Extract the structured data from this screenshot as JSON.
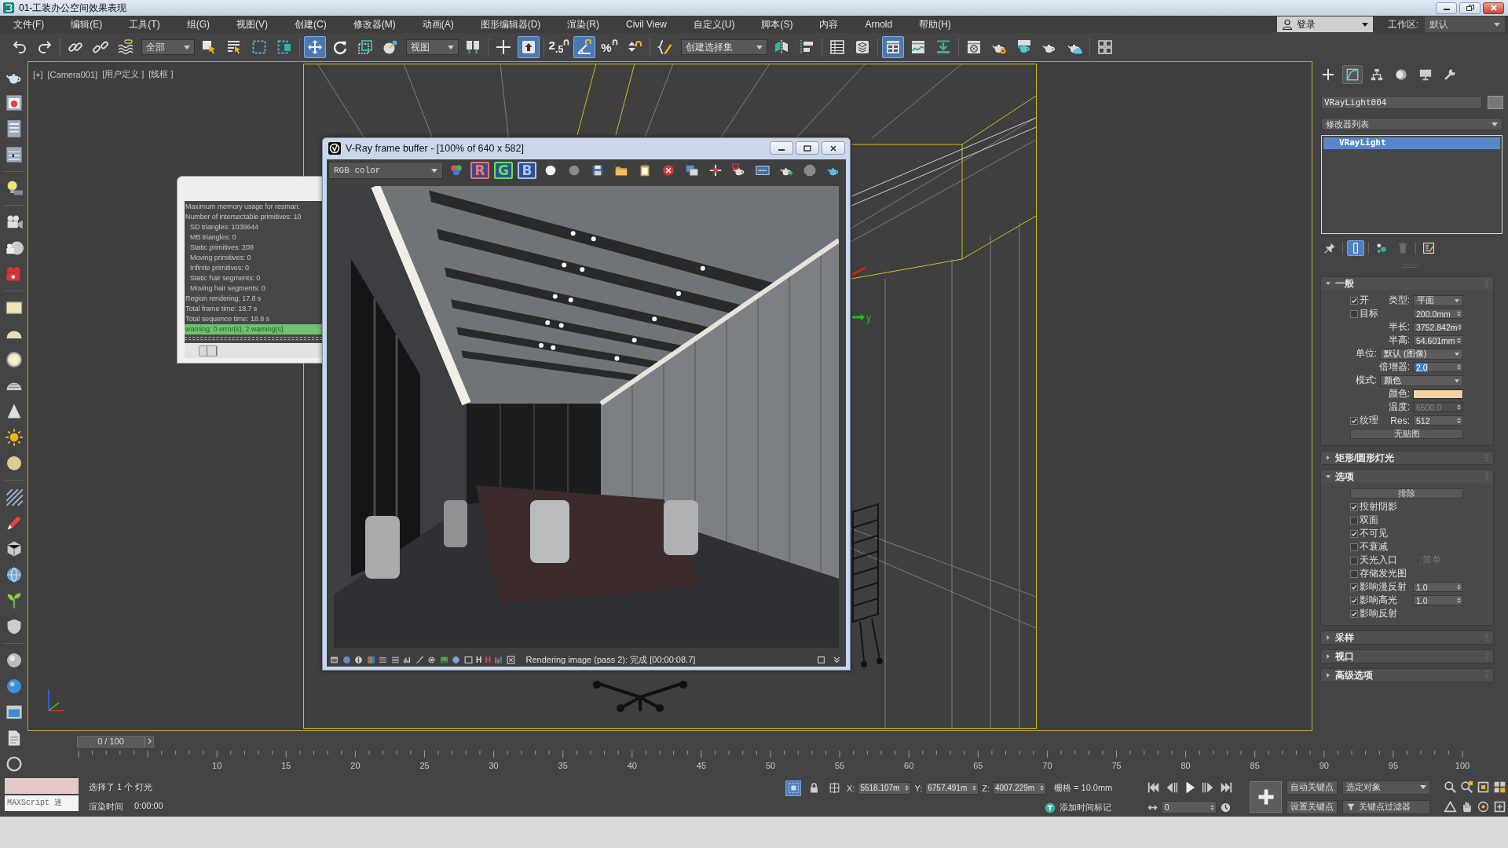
{
  "window": {
    "title": "01-工装办公空间效果表现"
  },
  "menu_bar": {
    "items": [
      "文件(F)",
      "编辑(E)",
      "工具(T)",
      "组(G)",
      "视图(V)",
      "创建(C)",
      "修改器(M)",
      "动画(A)",
      "图形编辑器(D)",
      "渲染(R)",
      "Civil View",
      "自定义(U)",
      "脚本(S)",
      "内容",
      "Arnold",
      "帮助(H)"
    ],
    "login": "登录",
    "workspace_label": "工作区:",
    "workspace": "默认"
  },
  "toolbar": [
    {
      "kind": "undo",
      "selected": false
    },
    {
      "kind": "redo",
      "selected": false
    },
    {
      "kind": "link",
      "selected": false
    },
    {
      "kind": "unlink",
      "selected": false
    },
    {
      "kind": "bind",
      "selected": false
    },
    {
      "kind": "dropdown",
      "value": "全部"
    },
    {
      "kind": "select",
      "selected": false
    },
    {
      "kind": "select_by_name",
      "selected": false
    },
    {
      "kind": "region",
      "selected": false
    },
    {
      "kind": "crossing",
      "selected": false
    },
    {
      "kind": "move",
      "selected": true
    },
    {
      "kind": "rotate",
      "selected": false
    },
    {
      "kind": "scale",
      "selected": false
    },
    {
      "kind": "place",
      "selected": false
    },
    {
      "kind": "dropdown",
      "value": "视图"
    },
    {
      "kind": "pivot",
      "selected": false
    },
    {
      "kind": "manipulate",
      "selected": false
    },
    {
      "kind": "override",
      "selected": true
    },
    {
      "kind": "snap",
      "selected": false,
      "label": "2$_{.5}$"
    },
    {
      "kind": "angle_snap",
      "selected": true
    },
    {
      "kind": "percent_snap",
      "selected": false,
      "label": "%"
    },
    {
      "kind": "spinner_snap",
      "selected": false
    },
    {
      "kind": "named_sets",
      "selected": false
    },
    {
      "kind": "dropdown",
      "value": "创建选择集"
    },
    {
      "kind": "mirror",
      "selected": false
    },
    {
      "kind": "align",
      "selected": false
    },
    {
      "kind": "layers",
      "selected": false
    },
    {
      "kind": "scene_explorer",
      "selected": false
    },
    {
      "kind": "ribbon",
      "selected": true
    },
    {
      "kind": "curve_editor",
      "selected": false
    },
    {
      "kind": "schematic",
      "selected": false
    },
    {
      "kind": "material_editor",
      "selected": false
    },
    {
      "kind": "render_setup",
      "selected": false
    },
    {
      "kind": "frame_window",
      "selected": false
    },
    {
      "kind": "render",
      "selected": false
    },
    {
      "kind": "cloud_render",
      "selected": false
    },
    {
      "kind": "viewports",
      "selected": false
    }
  ],
  "viewport": {
    "labels": [
      "[+]",
      "[Camera001]",
      "[用户定义 ]",
      "[线框 ]"
    ],
    "axis_label": "y"
  },
  "log_window": {
    "lines": [
      {
        "text": "Maximum memory usage for resman:",
        "highlighted": false
      },
      {
        "text": "Number of intersectable primitives: 10",
        "highlighted": false,
        "children": [
          {
            "text": "SD triangles: 1039644",
            "highlighted": false
          },
          {
            "text": "MB triangles: 0",
            "highlighted": false
          },
          {
            "text": "Static primitives: 208",
            "highlighted": false
          },
          {
            "text": "Moving primitives: 0",
            "highlighted": false
          },
          {
            "text": "Infinite primitives: 0",
            "highlighted": false
          },
          {
            "text": "Static hair segments: 0",
            "highlighted": false
          },
          {
            "text": "Moving hair segments: 0",
            "highlighted": false
          }
        ]
      },
      {
        "text": "Region rendering: 17.8 s",
        "highlighted": false
      },
      {
        "text": "Total frame time: 18.7 s",
        "highlighted": false
      },
      {
        "text": "Total sequence time: 18.8 s",
        "highlighted": false
      },
      {
        "text": "warning: 0 error(s), 2 warning(s)",
        "highlighted": true
      }
    ]
  },
  "vray_frame_buffer": {
    "title": "V-Ray frame buffer - [100% of 640 x 582]",
    "channel": "RGB color",
    "tools": [
      {
        "kind": "color_channels",
        "selected": false
      },
      {
        "kind": "channel",
        "label": "R",
        "color": "#ff7070",
        "selected": true
      },
      {
        "kind": "channel",
        "label": "G",
        "color": "#66e066",
        "selected": true
      },
      {
        "kind": "channel",
        "label": "B",
        "color": "#a8c4ff",
        "selected": true
      },
      {
        "kind": "white_dot",
        "selected": false
      },
      {
        "kind": "gray_dot",
        "selected": false
      },
      {
        "kind": "save",
        "selected": false
      },
      {
        "kind": "open",
        "selected": false
      },
      {
        "kind": "clipboard",
        "selected": false
      },
      {
        "kind": "clear",
        "selected": false
      },
      {
        "kind": "duplicate",
        "selected": false
      },
      {
        "kind": "track",
        "selected": false
      },
      {
        "kind": "region_render",
        "selected": false
      },
      {
        "kind": "lut",
        "selected": false
      },
      {
        "kind": "render_last",
        "selected": false
      },
      {
        "kind": "stop",
        "selected": false
      },
      {
        "kind": "interactive",
        "selected": false
      }
    ],
    "status_letters": [
      "H",
      "H"
    ],
    "status": "Rendering image (pass 2): 完成 [00:00:08.7]"
  },
  "command_panel": {
    "tabs": [
      {
        "kind": "create",
        "selected": false
      },
      {
        "kind": "modify",
        "selected": true
      },
      {
        "kind": "hierarchy",
        "selected": false
      },
      {
        "kind": "motion",
        "selected": false
      },
      {
        "kind": "display",
        "selected": false
      },
      {
        "kind": "utilities",
        "selected": false
      }
    ],
    "object_name": "VRayLight004",
    "modifier_list": "修改器列表",
    "stack": [
      {
        "label": "VRayLight",
        "selected": true
      }
    ],
    "stack_tools": [
      {
        "kind": "pin",
        "selected": false,
        "disabled": false
      },
      {
        "kind": "end_result",
        "selected": true,
        "disabled": false
      },
      {
        "kind": "make_unique",
        "selected": false,
        "disabled": false
      },
      {
        "kind": "remove",
        "selected": false,
        "disabled": true
      },
      {
        "kind": "configure",
        "selected": false,
        "disabled": false
      }
    ],
    "rollouts": [
      {
        "title": "一般",
        "expanded": true,
        "rows": [
          {
            "kind": "check",
            "label": "开",
            "checked": true,
            "disabled": false,
            "side": {
              "kind": "dropdown",
              "label": "类型:",
              "value": "平面",
              "disabled": false
            }
          },
          {
            "kind": "check",
            "label": "目标",
            "checked": false,
            "disabled": false,
            "side": {
              "kind": "spinner",
              "value": "200.0mm",
              "disabled": false,
              "focused": false
            }
          },
          {
            "kind": "spinner",
            "label": "半长:",
            "value": "3752.842m",
            "disabled": false,
            "focused": false
          },
          {
            "kind": "spinner",
            "label": "半高:",
            "value": "54.601mm",
            "disabled": false,
            "focused": false
          },
          {
            "kind": "dropdown",
            "label": "单位:",
            "value": "默认 (图像)",
            "disabled": false
          },
          {
            "kind": "spinner",
            "label": "倍增器:",
            "value": "2.0",
            "disabled": false,
            "focused": true
          },
          {
            "kind": "dropdown",
            "label": "模式:",
            "value": "颜色",
            "disabled": false
          },
          {
            "kind": "color",
            "label": "颜色:",
            "color": "#f3d3a4",
            "disabled": false
          },
          {
            "kind": "spinner",
            "label": "温度:",
            "value": "6500.0",
            "disabled": true,
            "focused": false
          },
          {
            "kind": "check",
            "label": "纹理",
            "checked": true,
            "disabled": false,
            "side": {
              "kind": "spinner",
              "label": "Res:",
              "value": "512",
              "disabled": false,
              "focused": false
            }
          },
          {
            "kind": "button",
            "label": "无贴图",
            "disabled": false
          }
        ]
      },
      {
        "title": "矩形/圆形灯光",
        "expanded": false
      },
      {
        "title": "选项",
        "expanded": true,
        "rows": [
          {
            "kind": "button",
            "label": "排除",
            "disabled": false
          },
          {
            "kind": "check",
            "label": "投射阴影",
            "checked": true,
            "disabled": false
          },
          {
            "kind": "check",
            "label": "双面",
            "checked": false,
            "disabled": false
          },
          {
            "kind": "check",
            "label": "不可见",
            "checked": true,
            "disabled": false
          },
          {
            "kind": "check",
            "label": "不衰减",
            "checked": false,
            "disabled": false
          },
          {
            "kind": "check",
            "label": "天光入口",
            "checked": false,
            "disabled": false,
            "side": {
              "kind": "check",
              "label": "简单",
              "checked": false,
              "disabled": true
            }
          },
          {
            "kind": "check",
            "label": "存储发光图",
            "checked": false,
            "disabled": false
          },
          {
            "kind": "check",
            "label": "影响漫反射",
            "checked": true,
            "disabled": false,
            "side": {
              "kind": "spinner",
              "value": "1.0",
              "disabled": false,
              "focused": false
            }
          },
          {
            "kind": "check",
            "label": "影响高光",
            "checked": true,
            "disabled": false,
            "side": {
              "kind": "spinner",
              "value": "1.0",
              "disabled": false,
              "focused": false
            }
          },
          {
            "kind": "check",
            "label": "影响反射",
            "checked": true,
            "disabled": false
          }
        ]
      },
      {
        "title": "采样",
        "expanded": false
      },
      {
        "title": "视口",
        "expanded": false
      },
      {
        "title": "高级选项",
        "expanded": false
      }
    ]
  },
  "timeline": {
    "time_slider": "0 / 100",
    "labels": [
      "10",
      "15",
      "20",
      "25",
      "30",
      "35",
      "40",
      "45",
      "50",
      "55",
      "60",
      "65",
      "70",
      "75",
      "80",
      "85",
      "90",
      "95",
      "100"
    ]
  },
  "status_bar": {
    "listener": "MAXScript 迷",
    "prompt": "选择了 1 个 灯光",
    "render_time_label": "渲染时间",
    "render_time": "0:00:00",
    "tools": [
      {
        "kind": "isolate",
        "selected": true
      },
      {
        "kind": "lock",
        "selected": false
      },
      {
        "kind": "absolute",
        "selected": false
      }
    ],
    "coords": [
      {
        "axis": "X:",
        "value": "5518.107m"
      },
      {
        "axis": "Y:",
        "value": "6757.491m"
      },
      {
        "axis": "Z:",
        "value": "4007.229m"
      }
    ],
    "grid": "栅格 = 10.0mm",
    "time_tag": "添加时间标记",
    "frame": "0",
    "auto_key": "自动关键点",
    "set_key": "设置关键点",
    "key_target": "选定对象",
    "key_filters": "关键点过滤器"
  }
}
